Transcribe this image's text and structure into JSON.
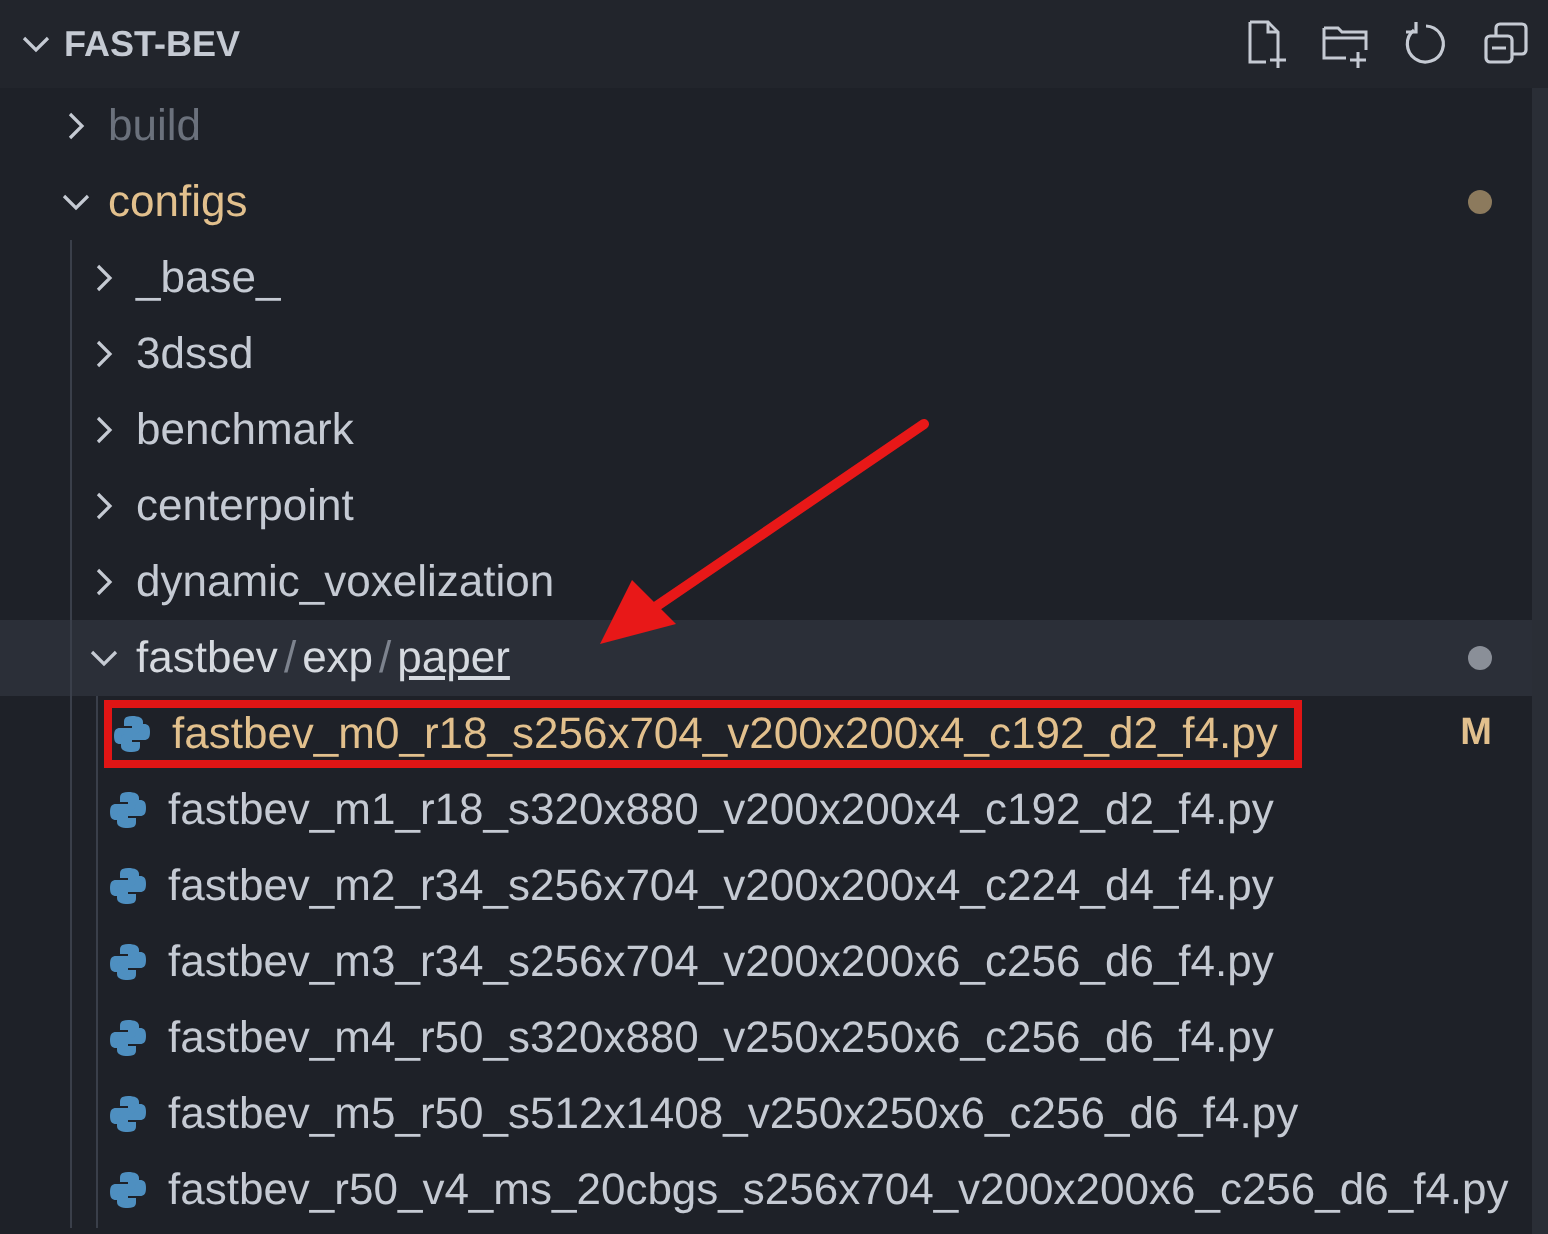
{
  "explorer": {
    "title": "FAST-BEV",
    "actions": [
      {
        "kind": "new-file"
      },
      {
        "kind": "new-folder"
      },
      {
        "kind": "refresh"
      },
      {
        "kind": "collapse"
      }
    ]
  },
  "tree": [
    {
      "kind": "folder",
      "name": "build",
      "expanded": false,
      "ignored": true
    },
    {
      "kind": "folder",
      "name": "configs",
      "expanded": true,
      "modified": true,
      "children": [
        {
          "kind": "folder",
          "name": "_base_",
          "expanded": false
        },
        {
          "kind": "folder",
          "name": "3dssd",
          "expanded": false
        },
        {
          "kind": "folder",
          "name": "benchmark",
          "expanded": false
        },
        {
          "kind": "folder",
          "name": "centerpoint",
          "expanded": false
        },
        {
          "kind": "folder",
          "name": "dynamic_voxelization",
          "expanded": false
        },
        {
          "kind": "compact-folder",
          "segments": [
            {
              "text": "fastbev",
              "focused": false
            },
            {
              "text": "exp",
              "focused": false
            },
            {
              "text": "paper",
              "focused": true
            }
          ],
          "separator": "/",
          "expanded": true,
          "selected": true,
          "modified": true,
          "children": [
            {
              "kind": "python-file",
              "name": "fastbev_m0_r18_s256x704_v200x200x4_c192_d2_f4.py",
              "modified": true,
              "badge": "M",
              "highlighted": true
            },
            {
              "kind": "python-file",
              "name": "fastbev_m1_r18_s320x880_v200x200x4_c192_d2_f4.py",
              "modified": false
            },
            {
              "kind": "python-file",
              "name": "fastbev_m2_r34_s256x704_v200x200x4_c224_d4_f4.py",
              "modified": false
            },
            {
              "kind": "python-file",
              "name": "fastbev_m3_r34_s256x704_v200x200x6_c256_d6_f4.py",
              "modified": false
            },
            {
              "kind": "python-file",
              "name": "fastbev_m4_r50_s320x880_v250x250x6_c256_d6_f4.py",
              "modified": false
            },
            {
              "kind": "python-file",
              "name": "fastbev_m5_r50_s512x1408_v250x250x6_c256_d6_f4.py",
              "modified": false
            },
            {
              "kind": "python-file",
              "name": "fastbev_r50_v4_ms_20cbgs_s256x704_v200x200x6_c256_d6_f4.py",
              "modified": false
            }
          ]
        }
      ]
    }
  ],
  "annotations": [
    {
      "kind": "arrow"
    }
  ]
}
